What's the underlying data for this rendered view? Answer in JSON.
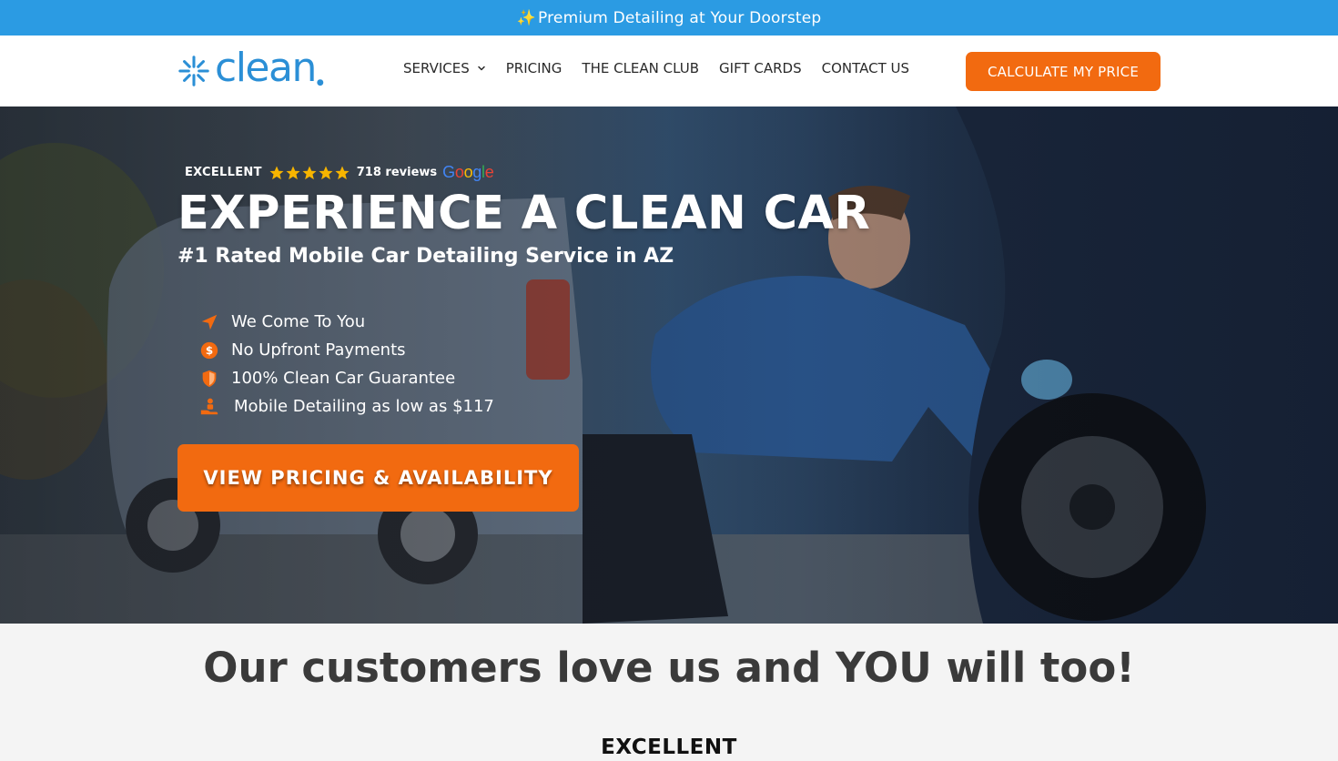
{
  "announcement": {
    "icon": "sparkles-icon",
    "text": "Premium Detailing at Your Doorstep"
  },
  "header": {
    "logo_text": "clean",
    "nav": [
      {
        "label": "SERVICES",
        "has_dropdown": true
      },
      {
        "label": "PRICING"
      },
      {
        "label": "THE CLEAN CLUB"
      },
      {
        "label": "GIFT CARDS"
      },
      {
        "label": "CONTACT US"
      }
    ],
    "cta_label": "CALCULATE MY PRICE"
  },
  "hero": {
    "rating": {
      "label": "EXCELLENT",
      "stars": 5,
      "reviews": "718 reviews",
      "provider": "Google"
    },
    "title": "EXPERIENCE A CLEAN CAR",
    "subtitle": "#1 Rated Mobile Car Detailing Service in AZ",
    "features": [
      {
        "icon": "location-arrow-icon",
        "text": "We Come To You"
      },
      {
        "icon": "dollar-coin-icon",
        "text": "No Upfront Payments"
      },
      {
        "icon": "shield-icon",
        "text": "100% Clean Car Guarantee"
      },
      {
        "icon": "hand-person-icon",
        "text": "Mobile Detailing as low as $117"
      }
    ],
    "cta_label": "VIEW PRICING & AVAILABILITY"
  },
  "testimonials": {
    "heading": "Our customers love us and YOU will too!",
    "rating_label": "EXCELLENT"
  },
  "colors": {
    "brand_blue": "#2b9be3",
    "accent_orange": "#f26a10",
    "logo_blue": "#2b8fd6"
  }
}
